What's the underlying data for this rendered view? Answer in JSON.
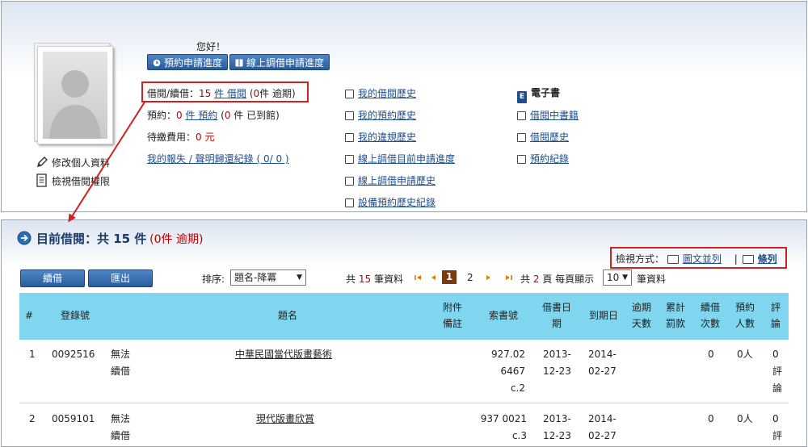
{
  "profile": {
    "greeting": "您好！",
    "edit_profile": "修改個人資料",
    "view_permission": "檢視借閱權限"
  },
  "toolbar": {
    "reservation_progress": "預約申請進度",
    "online_ill_progress": "線上調借申請進度"
  },
  "status": {
    "borrow_label": "借閱/續借：",
    "borrow_count": "15",
    "borrow_unit": "件 借閱",
    "borrow_paren_open": "(",
    "overdue_count": "0",
    "overdue_unit": "件 逾期)",
    "reserve_label": "預約：",
    "reserve_count": "0",
    "reserve_unit": "件 預約",
    "reserve_paren_open": "(",
    "arrived_count": "0",
    "arrived_unit": "件 已到館)",
    "fee_label": "待繳費用：",
    "fee_value": "0 元",
    "lost_record": "我的報失 / 聲明歸還紀錄 ( 0/ 0 )"
  },
  "menu_middle": [
    {
      "label": "我的借閱歷史",
      "icon": "list-icon"
    },
    {
      "label": "我的預約歷史",
      "icon": "search-icon"
    },
    {
      "label": "我的違規歷史",
      "icon": "warning-icon"
    },
    {
      "label": "線上調借目前申請進度",
      "icon": "card-icon"
    },
    {
      "label": "線上調借申請歷史",
      "icon": "mail-icon"
    },
    {
      "label": "設備預約歷史紀錄",
      "icon": "key-icon"
    }
  ],
  "menu_ebook": {
    "title": "電子書",
    "icon_letter": "E",
    "items": [
      {
        "label": "借閱中書籍",
        "icon": "list-icon"
      },
      {
        "label": "借閱歷史",
        "icon": "search-icon"
      },
      {
        "label": "預約紀錄",
        "icon": "calendar-icon"
      }
    ]
  },
  "section": {
    "title": "目前借閱：共 15 件",
    "overdue_note": "(0件 逾期)"
  },
  "view_mode": {
    "label": "檢視方式：",
    "option_graphic": "圖文並列",
    "separator": "|",
    "option_list": "條列"
  },
  "actions": {
    "renew": "續借",
    "export": "匯出"
  },
  "sort": {
    "label": "排序:",
    "selected": "題名-降冪"
  },
  "pagination": {
    "total_prefix": "共",
    "total_count": "15",
    "total_suffix": "筆資料",
    "current_page": "1",
    "next_page": "2",
    "pages_prefix": "共",
    "pages_count": "2",
    "pages_suffix": "頁 每頁顯示",
    "per_page": "10",
    "per_page_suffix": "筆資料"
  },
  "table": {
    "headers": {
      "num": "#",
      "reg": "登錄號",
      "title": "題名",
      "attach_1": "附件",
      "attach_2": "備註",
      "call": "索書號",
      "borrow_1": "借書日",
      "borrow_2": "期",
      "due": "到期日",
      "overdue_1": "逾期",
      "overdue_2": "天數",
      "fine_1": "累計",
      "fine_2": "罰款",
      "renew_1": "續借",
      "renew_2": "次數",
      "reserve_1": "預約",
      "reserve_2": "人數",
      "review_1": "評",
      "review_2": "論"
    },
    "rows": [
      {
        "num": "1",
        "reg": "0092516",
        "status_1": "無法",
        "status_2": "續借",
        "title": "中華民國當代版畫藝術",
        "call_1": "927.02",
        "call_2": "6467 c.2",
        "borrow_1": "2013-",
        "borrow_2": "12-23",
        "due_1": "2014-",
        "due_2": "02-27",
        "renew_count": "0",
        "reserve_count": "0人",
        "review_1": "0",
        "review_2": "評",
        "review_3": "論"
      },
      {
        "num": "2",
        "reg": "0059101",
        "status_1": "無法",
        "status_2": "續借",
        "title": "現代版畫欣賞",
        "call_1": "937 0021",
        "call_2": "c.3",
        "borrow_1": "2013-",
        "borrow_2": "12-23",
        "due_1": "2014-",
        "due_2": "02-27",
        "renew_count": "0",
        "reserve_count": "0人",
        "review_1": "0",
        "review_2": "評",
        "review_3": ""
      }
    ]
  },
  "colors": {
    "accent_red": "#c00000",
    "link_blue": "#1f4e8c",
    "table_header": "#7fd6ee",
    "highlight_box": "#cc2222"
  }
}
